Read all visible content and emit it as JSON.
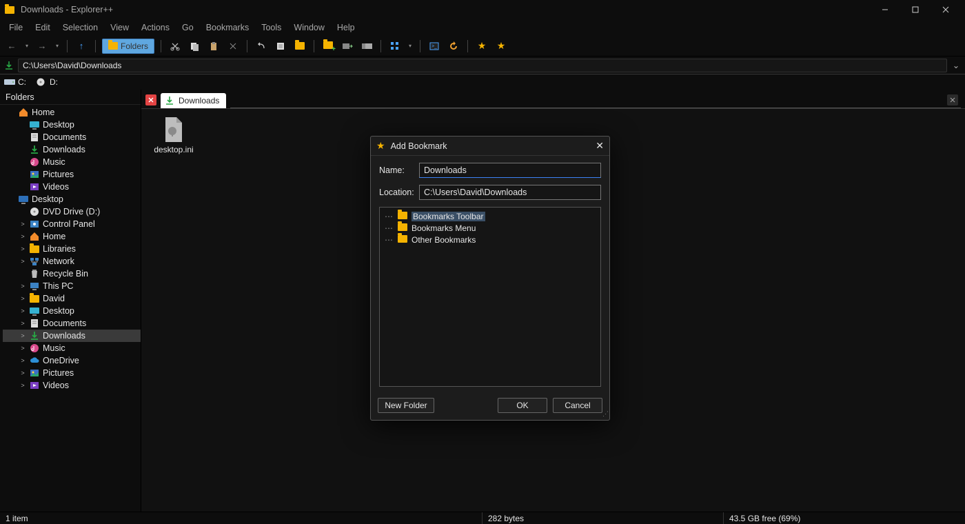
{
  "window": {
    "title": "Downloads - Explorer++"
  },
  "menu": [
    "File",
    "Edit",
    "Selection",
    "View",
    "Actions",
    "Go",
    "Bookmarks",
    "Tools",
    "Window",
    "Help"
  ],
  "toolbar": {
    "folders_label": "Folders"
  },
  "address": {
    "path": "C:\\Users\\David\\Downloads"
  },
  "drives": [
    "C:",
    "D:"
  ],
  "sidebar": {
    "title": "Folders"
  },
  "tree": [
    {
      "d": 0,
      "tw": "",
      "icon": "home",
      "label": "Home"
    },
    {
      "d": 1,
      "tw": "",
      "icon": "desktop",
      "label": "Desktop"
    },
    {
      "d": 1,
      "tw": "",
      "icon": "doc",
      "label": "Documents"
    },
    {
      "d": 1,
      "tw": "",
      "icon": "dl",
      "label": "Downloads"
    },
    {
      "d": 1,
      "tw": "",
      "icon": "music",
      "label": "Music"
    },
    {
      "d": 1,
      "tw": "",
      "icon": "pic",
      "label": "Pictures"
    },
    {
      "d": 1,
      "tw": "",
      "icon": "vid",
      "label": "Videos"
    },
    {
      "d": 0,
      "tw": "",
      "icon": "desktop2",
      "label": "Desktop"
    },
    {
      "d": 1,
      "tw": "",
      "icon": "dvd",
      "label": "DVD Drive (D:)"
    },
    {
      "d": 1,
      "tw": ">",
      "icon": "ctrl",
      "label": "Control Panel"
    },
    {
      "d": 1,
      "tw": ">",
      "icon": "home",
      "label": "Home"
    },
    {
      "d": 1,
      "tw": ">",
      "icon": "lib",
      "label": "Libraries"
    },
    {
      "d": 1,
      "tw": ">",
      "icon": "net",
      "label": "Network"
    },
    {
      "d": 1,
      "tw": "",
      "icon": "bin",
      "label": "Recycle Bin"
    },
    {
      "d": 1,
      "tw": ">",
      "icon": "pc",
      "label": "This PC"
    },
    {
      "d": 1,
      "tw": ">",
      "icon": "folder",
      "label": "David"
    },
    {
      "d": 1,
      "tw": ">",
      "icon": "desktop",
      "label": "Desktop"
    },
    {
      "d": 1,
      "tw": ">",
      "icon": "doc",
      "label": "Documents"
    },
    {
      "d": 1,
      "tw": ">",
      "icon": "dl",
      "label": "Downloads",
      "sel": true
    },
    {
      "d": 1,
      "tw": ">",
      "icon": "music",
      "label": "Music"
    },
    {
      "d": 1,
      "tw": ">",
      "icon": "cloud",
      "label": "OneDrive"
    },
    {
      "d": 1,
      "tw": ">",
      "icon": "pic",
      "label": "Pictures"
    },
    {
      "d": 1,
      "tw": ">",
      "icon": "vid",
      "label": "Videos"
    }
  ],
  "tab": {
    "label": "Downloads"
  },
  "files": [
    {
      "name": "desktop.ini"
    }
  ],
  "status": {
    "items": "1 item",
    "size": "282 bytes",
    "free": "43.5 GB free (69%)"
  },
  "dialog": {
    "title": "Add Bookmark",
    "name_label": "Name:",
    "name_value": "Downloads",
    "loc_label": "Location:",
    "loc_value": "C:\\Users\\David\\Downloads",
    "folders": [
      {
        "label": "Bookmarks Toolbar",
        "sel": true
      },
      {
        "label": "Bookmarks Menu"
      },
      {
        "label": "Other Bookmarks"
      }
    ],
    "new_folder": "New Folder",
    "ok": "OK",
    "cancel": "Cancel"
  }
}
